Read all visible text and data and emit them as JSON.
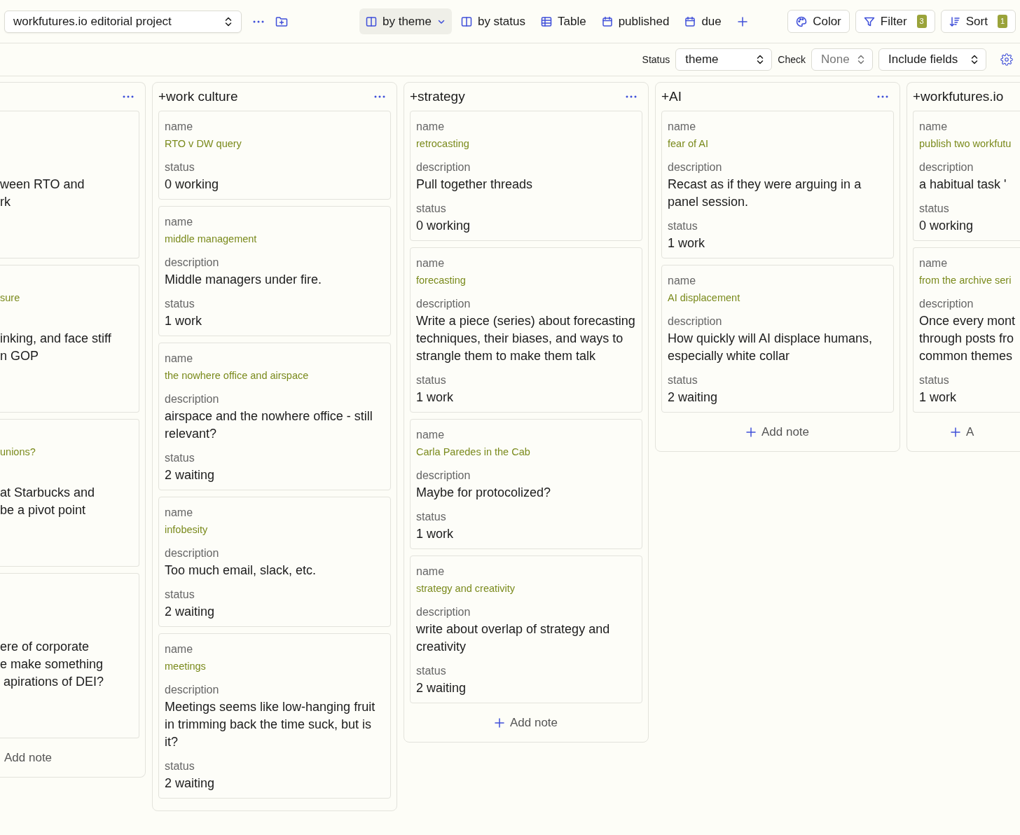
{
  "toolbar": {
    "project": "workfutures.io editorial project",
    "views": [
      {
        "label": "by theme",
        "selected": true
      },
      {
        "label": "by status",
        "selected": false
      },
      {
        "label": "Table",
        "selected": false
      },
      {
        "label": "published",
        "selected": false
      },
      {
        "label": "due",
        "selected": false
      }
    ],
    "actions": [
      {
        "label": "Color"
      },
      {
        "label": "Filter",
        "badge": "3"
      },
      {
        "label": "Sort",
        "badge": "1"
      }
    ]
  },
  "options": {
    "status_label": "Status",
    "status_value": "theme",
    "check_label": "Check",
    "check_value": "None",
    "check_disabled": true,
    "include_fields": "Include fields"
  },
  "columns": [
    {
      "kind": "clipped-left",
      "add_note": "Add note",
      "cards": [
        {
          "fields": [
            {
              "kind": "name"
            },
            {
              "kind": "description",
              "value": "ween RTO and\nrk"
            },
            {
              "kind": "status"
            }
          ]
        },
        {
          "fields": [
            {
              "kind": "name",
              "value": "sure"
            },
            {
              "kind": "description",
              "value": "inking, and face stiff\nn GOP"
            },
            {
              "kind": "status"
            }
          ]
        },
        {
          "fields": [
            {
              "kind": "name",
              "value": "unions?"
            },
            {
              "kind": "description",
              "value": "at Starbucks and\nbe a pivot point"
            },
            {
              "kind": "status"
            }
          ]
        },
        {
          "fields": [
            {
              "kind": "name"
            },
            {
              "kind": "description",
              "value": "ere of corporate\ne make something\n apirations of DEI?"
            },
            {
              "kind": "status"
            }
          ]
        }
      ]
    },
    {
      "kind": "full",
      "title": "+work culture",
      "cards": [
        {
          "fields": [
            {
              "kind": "name",
              "label": "name",
              "value": "RTO v DW query"
            },
            {
              "kind": "status",
              "label": "status",
              "value": "0 working"
            }
          ]
        },
        {
          "fields": [
            {
              "kind": "name",
              "label": "name",
              "value": "middle management"
            },
            {
              "kind": "description",
              "label": "description",
              "value": "Middle managers under fire."
            },
            {
              "kind": "status",
              "label": "status",
              "value": "1 work"
            }
          ]
        },
        {
          "fields": [
            {
              "kind": "name",
              "label": "name",
              "value": "the nowhere office and airspace"
            },
            {
              "kind": "description",
              "label": "description",
              "value": "airspace and the nowhere office - still relevant?"
            },
            {
              "kind": "status",
              "label": "status",
              "value": "2 waiting"
            }
          ]
        },
        {
          "fields": [
            {
              "kind": "name",
              "label": "name",
              "value": "infobesity"
            },
            {
              "kind": "description",
              "label": "description",
              "value": "Too much email, slack, etc."
            },
            {
              "kind": "status",
              "label": "status",
              "value": "2 waiting"
            }
          ]
        },
        {
          "fields": [
            {
              "kind": "name",
              "label": "name",
              "value": "meetings"
            },
            {
              "kind": "description",
              "label": "description",
              "value": "Meetings seems like low-hanging fruit in trimming back the time suck, but is it?"
            },
            {
              "kind": "status",
              "label": "status",
              "value": "2 waiting"
            }
          ]
        }
      ]
    },
    {
      "kind": "full",
      "title": "+strategy",
      "add_note": "Add note",
      "cards": [
        {
          "fields": [
            {
              "kind": "name",
              "label": "name",
              "value": "retrocasting"
            },
            {
              "kind": "description",
              "label": "description",
              "value": "Pull together threads"
            },
            {
              "kind": "status",
              "label": "status",
              "value": "0 working"
            }
          ]
        },
        {
          "fields": [
            {
              "kind": "name",
              "label": "name",
              "value": "forecasting"
            },
            {
              "kind": "description",
              "label": "description",
              "value": "Write a piece (series) about forecasting techniques, their biases, and ways to strangle them to make them talk"
            },
            {
              "kind": "status",
              "label": "status",
              "value": "1 work"
            }
          ]
        },
        {
          "fields": [
            {
              "kind": "name",
              "label": "name",
              "value": "Carla Paredes in the Cab"
            },
            {
              "kind": "description",
              "label": "description",
              "value": "Maybe for protocolized?"
            },
            {
              "kind": "status",
              "label": "status",
              "value": "1 work"
            }
          ]
        },
        {
          "fields": [
            {
              "kind": "name",
              "label": "name",
              "value": "strategy and creativity"
            },
            {
              "kind": "description",
              "label": "description",
              "value": "write about overlap of strategy and creativity"
            },
            {
              "kind": "status",
              "label": "status",
              "value": "2 waiting"
            }
          ]
        }
      ]
    },
    {
      "kind": "full",
      "title": "+AI",
      "add_note": "Add note",
      "cards": [
        {
          "fields": [
            {
              "kind": "name",
              "label": "name",
              "value": "fear of AI"
            },
            {
              "kind": "description",
              "label": "description",
              "value": "Recast as if they were arguing in a panel session."
            },
            {
              "kind": "status",
              "label": "status",
              "value": "1 work"
            }
          ]
        },
        {
          "fields": [
            {
              "kind": "name",
              "label": "name",
              "value": "AI displacement"
            },
            {
              "kind": "description",
              "label": "description",
              "value": "How quickly will AI displace humans, especially white collar"
            },
            {
              "kind": "status",
              "label": "status",
              "value": "2 waiting"
            }
          ]
        }
      ]
    },
    {
      "kind": "clipped-right",
      "title": "+workfutures.io",
      "add_note": "A",
      "cards": [
        {
          "fields": [
            {
              "kind": "name",
              "label": "name",
              "value": "publish two workfutu"
            },
            {
              "kind": "description",
              "label": "description",
              "value": "a habitual task '"
            },
            {
              "kind": "status",
              "label": "status",
              "value": "0 working"
            }
          ]
        },
        {
          "fields": [
            {
              "kind": "name",
              "label": "name",
              "value": "from the archive seri"
            },
            {
              "kind": "description",
              "label": "description",
              "value": "Once every mont\nthrough posts fro\ncommon themes"
            },
            {
              "kind": "status",
              "label": "status",
              "value": "1 work"
            }
          ]
        }
      ]
    }
  ]
}
